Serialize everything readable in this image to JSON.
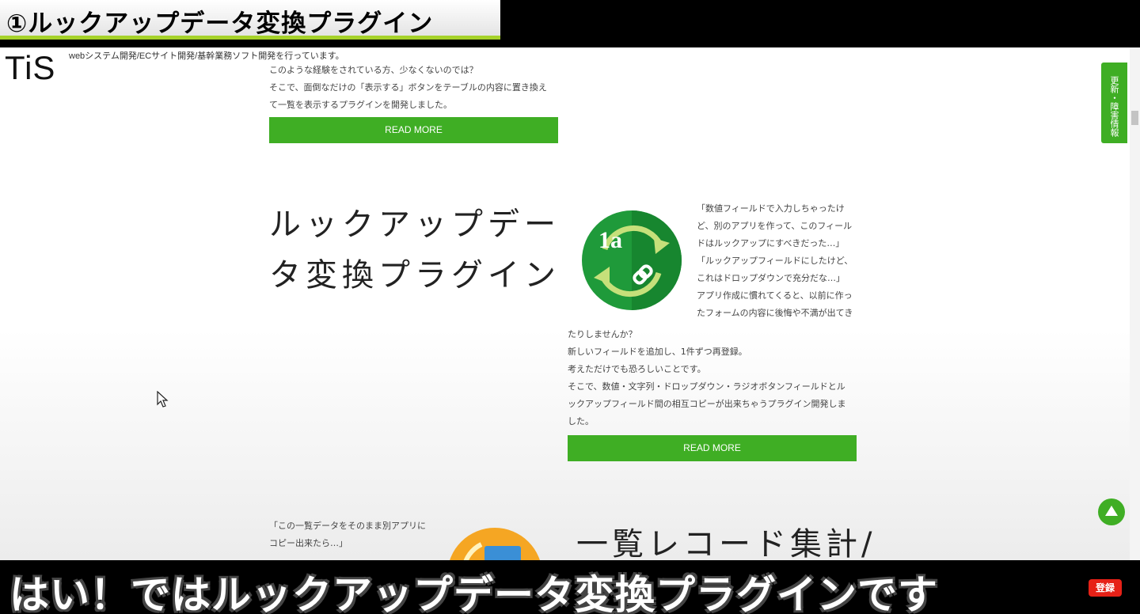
{
  "video": {
    "top_caption": "①ルックアップデータ変換プラグイン",
    "bottom_caption": "はい！ではルックアップデータ変換プラグインです",
    "subscribe_badge": "登録"
  },
  "site": {
    "logo_text": "TiS",
    "tagline": "webシステム開発/ECサイト開発/基幹業務ソフト開発を行っています。",
    "update_tab": "更新・障害情報"
  },
  "section1": {
    "lines": [
      "このような経験をされている方、少なくないのでは？",
      "そこで、面倒なだけの「表示する」ボタンをテーブルの内容に置き換え",
      "て一覧を表示するプラグインを開発しました。"
    ],
    "button": "READ MORE"
  },
  "section2": {
    "title_lines": [
      "ルックアップデー",
      "タ変換プラグイン"
    ],
    "icon_label": "1a",
    "side_lines": [
      "「数値フィールドで入力しちゃったけ",
      "ど、別のアプリを作って、このフィール",
      "ドはルックアップにすべきだった…」",
      "「ルックアップフィールドにしたけど、",
      "これはドロップダウンで充分だな…」",
      "アプリ作成に慣れてくると、以前に作っ",
      "たフォームの内容に後悔や不満が出てき"
    ],
    "full_lines": [
      "たりしませんか？",
      "新しいフィールドを追加し、1件ずつ再登録。",
      "考えただけでも恐ろしいことです。",
      "そこで、数値・文字列・ドロップダウン・ラジオボタンフィールドとル",
      "ックアップフィールド間の相互コピーが出来ちゃうプラグイン開発しま",
      "した。"
    ],
    "button": "READ MORE"
  },
  "section3": {
    "lines": [
      "「この一覧データをそのまま別アプリに",
      "コピー出来たら…」"
    ],
    "title": "一覧レコード集計/"
  },
  "colors": {
    "accent_green": "#3fae24",
    "caption_underline": "#a6d22a",
    "subscribe_red": "#e62117"
  }
}
